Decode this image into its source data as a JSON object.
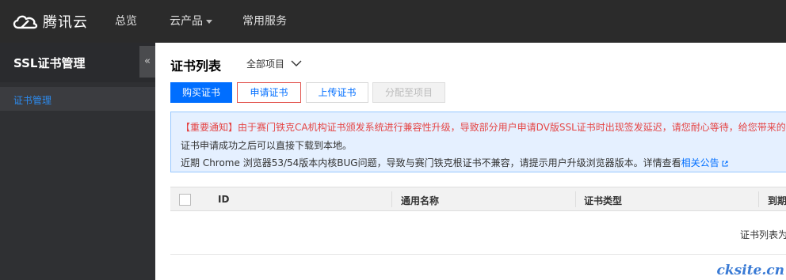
{
  "topnav": {
    "logo_text": "腾讯云",
    "items": [
      {
        "label": "总览"
      },
      {
        "label": "云产品"
      },
      {
        "label": "常用服务"
      }
    ]
  },
  "sidebar": {
    "title": "SSL证书管理",
    "collapse_glyph": "«",
    "items": [
      {
        "label": "证书管理",
        "active": true
      }
    ]
  },
  "main": {
    "title": "证书列表",
    "project_select": "全部项目",
    "buttons": {
      "buy": "购买证书",
      "apply": "申请证书",
      "upload": "上传证书",
      "assign": "分配至项目"
    },
    "notice": {
      "line1": "【重要通知】由于赛门铁克CA机构证书颁发系统进行兼容性升级，导致部分用户申请DV版SSL证书时出现签发延迟，请您耐心等待，给您带来的不",
      "line2": "证书申请成功之后可以直接下载到本地。",
      "line3_prefix": "近期 Chrome 浏览器53/54版本内核BUG问题，导致与赛门铁克根证书不兼容，请提示用户升级浏览器版本。详情查看",
      "line3_link": "相关公告"
    },
    "table": {
      "columns": [
        "ID",
        "通用名称",
        "证书类型",
        "到期"
      ],
      "empty_text": "证书列表为"
    }
  },
  "watermark": "cksite.cn",
  "colors": {
    "topbar": "#2b2b2b",
    "sidebar": "#2f3033",
    "primary": "#006eff",
    "notice_bg": "#e5f0ff",
    "notice_red": "#e54545"
  }
}
